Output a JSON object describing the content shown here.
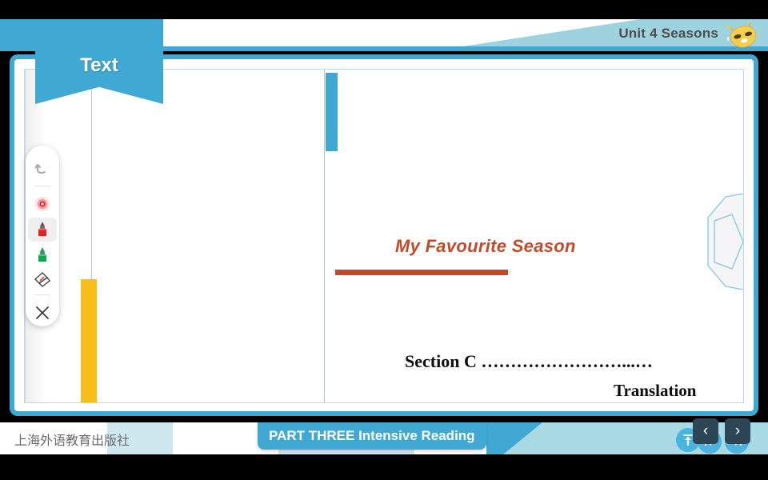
{
  "header": {
    "title": "Unit 4 Seasons",
    "bee_icon": "bee-emoji-icon"
  },
  "tab": {
    "label": "Text"
  },
  "toolbar": {
    "items": [
      {
        "name": "undo-icon",
        "label": "Undo"
      },
      {
        "name": "laser-pointer-icon",
        "label": "Laser pointer"
      },
      {
        "name": "red-marker-icon",
        "label": "Red marker"
      },
      {
        "name": "green-marker-icon",
        "label": "Green marker"
      },
      {
        "name": "eraser-icon",
        "label": "Eraser"
      },
      {
        "name": "close-icon",
        "label": "Close"
      }
    ]
  },
  "content": {
    "title": "My Favourite Season",
    "section": "Section C ……………………...…",
    "translation": "Translation",
    "link_one": "I",
    "link_two": "II"
  },
  "footer": {
    "publisher": "上海外语教育出版社",
    "part_label": "PART THREE Intensive Reading",
    "up_icon": "upload-arrow-icon",
    "prev_icon": "previous-chevron-icon",
    "next_icon": "next-chevron-icon",
    "prev_glyph": "‹",
    "next_glyph": "›"
  },
  "colors": {
    "brand_blue": "#3fa9d3",
    "header_teal": "#9ed2de",
    "title_orange": "#c4492b",
    "accent_yellow": "#f6bd1b",
    "link_yellow": "#f6b937"
  }
}
